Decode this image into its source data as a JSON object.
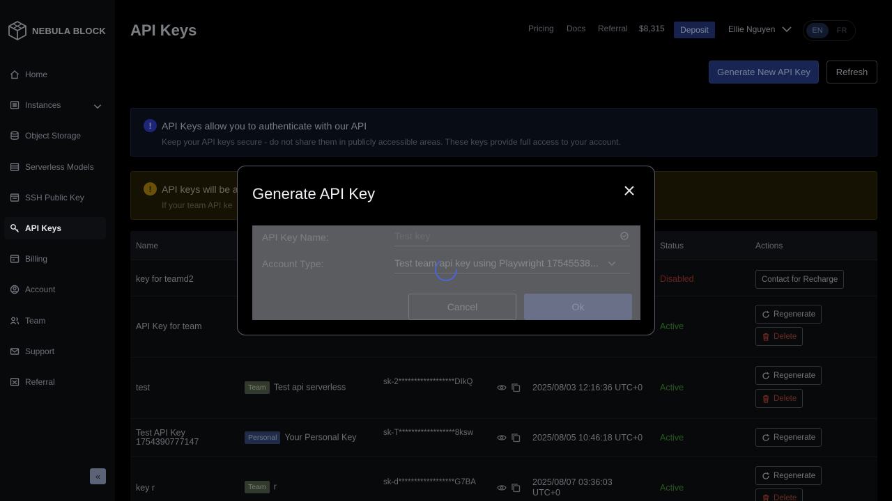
{
  "brand": {
    "name": "NEBULA BLOCK"
  },
  "sidebar": {
    "items": [
      {
        "label": "Home",
        "icon": "home-icon"
      },
      {
        "label": "Instances",
        "icon": "server-icon"
      },
      {
        "label": "Object Storage",
        "icon": "database-icon"
      },
      {
        "label": "Serverless Models",
        "icon": "layers-icon"
      },
      {
        "label": "SSH Public Key",
        "icon": "terminal-icon"
      },
      {
        "label": "API Keys",
        "icon": "key-icon",
        "active": true
      },
      {
        "label": "Billing",
        "icon": "billing-icon"
      },
      {
        "label": "Account",
        "icon": "account-icon"
      },
      {
        "label": "Team",
        "icon": "team-icon"
      },
      {
        "label": "Support",
        "icon": "mail-icon"
      },
      {
        "label": "Referral",
        "icon": "referral-icon"
      }
    ],
    "collapse_icon": "«"
  },
  "header": {
    "title": "API Keys",
    "links": [
      "Pricing",
      "Docs",
      "Referral"
    ],
    "balance": "$8,315",
    "deposit_label": "Deposit",
    "user": "Ellie Nguyen",
    "lang_en": "EN",
    "lang_fr": "FR"
  },
  "actions": {
    "generate_label": "Generate New API Key",
    "refresh_label": "Refresh"
  },
  "banners": {
    "info": {
      "icon": "!",
      "title": "API Keys allow you to authenticate with our API",
      "subtitle": "Keep your API keys secure - do not share them in publicly accessible areas. These keys provide full access to your account."
    },
    "warning": {
      "icon": "!",
      "title": "API keys will be a",
      "subtitle": "If your team API ke"
    }
  },
  "table": {
    "headers": {
      "name": "Name",
      "status": "Status",
      "actions": "Actions"
    },
    "rows": [
      {
        "name": "key for teamd2",
        "status": "Disabled",
        "action1": "Contact for Recharge"
      },
      {
        "name": "API Key for team",
        "status": "Active",
        "action1": "Regenerate",
        "action2": "Delete"
      },
      {
        "name": "test",
        "tag": "Team",
        "description": "Test api serverless",
        "key": "sk-2******************DIkQ",
        "created": "2025/08/03 12:16:36 UTC+0",
        "status": "Active",
        "action1": "Regenerate",
        "action2": "Delete"
      },
      {
        "name": "Test API Key 1754390777147",
        "tag": "Personal",
        "description": "Your Personal Key",
        "key": "sk-T******************8ksw",
        "created": "2025/08/05 10:46:18 UTC+0",
        "status": "Active",
        "action1": "Regenerate"
      },
      {
        "name": "key r",
        "tag": "Team",
        "description": "r",
        "key": "sk-d******************G7BA",
        "created": "2025/08/07 03:36:03 UTC+0",
        "status": "Active",
        "action1": "Regenerate",
        "action2": "Delete"
      }
    ]
  },
  "modal": {
    "title": "Generate API Key",
    "name_label": "API Key Name:",
    "name_placeholder": "Test key",
    "type_label": "Account Type:",
    "type_value": "Test team api key using Playwright 17545538...",
    "cancel_label": "Cancel",
    "ok_label": "Ok"
  }
}
